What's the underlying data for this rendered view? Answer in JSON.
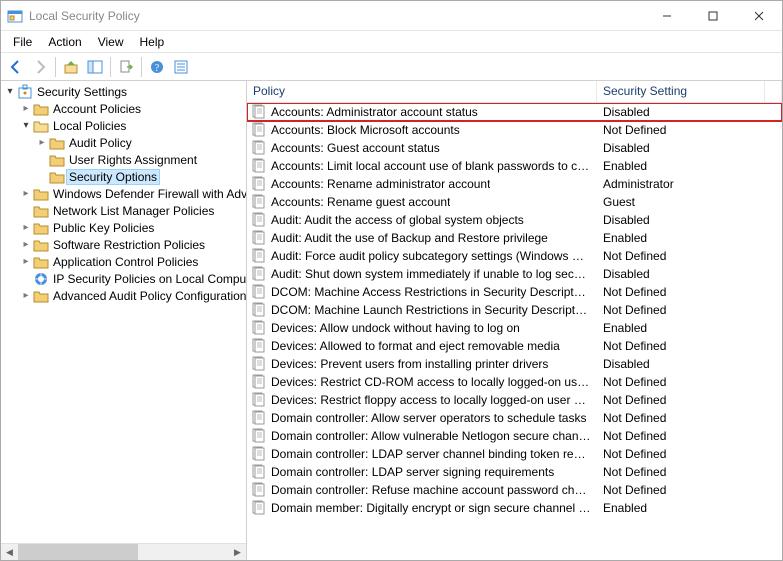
{
  "window": {
    "title": "Local Security Policy"
  },
  "menubar": [
    "File",
    "Action",
    "View",
    "Help"
  ],
  "tree": {
    "root": "Security Settings",
    "nodes": [
      {
        "label": "Account Policies",
        "indent": 1,
        "expanded": false,
        "hasChildren": true,
        "icon": "folder"
      },
      {
        "label": "Local Policies",
        "indent": 1,
        "expanded": true,
        "hasChildren": true,
        "icon": "folder-open"
      },
      {
        "label": "Audit Policy",
        "indent": 2,
        "expanded": false,
        "hasChildren": true,
        "icon": "folder"
      },
      {
        "label": "User Rights Assignment",
        "indent": 2,
        "expanded": false,
        "hasChildren": false,
        "icon": "folder"
      },
      {
        "label": "Security Options",
        "indent": 2,
        "expanded": false,
        "hasChildren": false,
        "icon": "folder",
        "selected": true
      },
      {
        "label": "Windows Defender Firewall with Advanced Security",
        "indent": 1,
        "expanded": false,
        "hasChildren": true,
        "icon": "folder"
      },
      {
        "label": "Network List Manager Policies",
        "indent": 1,
        "expanded": false,
        "hasChildren": false,
        "icon": "folder"
      },
      {
        "label": "Public Key Policies",
        "indent": 1,
        "expanded": false,
        "hasChildren": true,
        "icon": "folder"
      },
      {
        "label": "Software Restriction Policies",
        "indent": 1,
        "expanded": false,
        "hasChildren": true,
        "icon": "folder"
      },
      {
        "label": "Application Control Policies",
        "indent": 1,
        "expanded": false,
        "hasChildren": true,
        "icon": "folder"
      },
      {
        "label": "IP Security Policies on Local Computer",
        "indent": 1,
        "expanded": false,
        "hasChildren": false,
        "icon": "ipsec"
      },
      {
        "label": "Advanced Audit Policy Configuration",
        "indent": 1,
        "expanded": false,
        "hasChildren": true,
        "icon": "folder"
      }
    ]
  },
  "columns": {
    "policy": "Policy",
    "setting": "Security Setting"
  },
  "policies": [
    {
      "name": "Accounts: Administrator account status",
      "value": "Disabled",
      "highlighted": true
    },
    {
      "name": "Accounts: Block Microsoft accounts",
      "value": "Not Defined"
    },
    {
      "name": "Accounts: Guest account status",
      "value": "Disabled"
    },
    {
      "name": "Accounts: Limit local account use of blank passwords to console logon only",
      "value": "Enabled"
    },
    {
      "name": "Accounts: Rename administrator account",
      "value": "Administrator"
    },
    {
      "name": "Accounts: Rename guest account",
      "value": "Guest"
    },
    {
      "name": "Audit: Audit the access of global system objects",
      "value": "Disabled"
    },
    {
      "name": "Audit: Audit the use of Backup and Restore privilege",
      "value": "Enabled"
    },
    {
      "name": "Audit: Force audit policy subcategory settings (Windows Vista or later) to override audit policy category settings",
      "value": "Not Defined"
    },
    {
      "name": "Audit: Shut down system immediately if unable to log security audits",
      "value": "Disabled"
    },
    {
      "name": "DCOM: Machine Access Restrictions in Security Descriptor Definition Language (SDDL) syntax",
      "value": "Not Defined"
    },
    {
      "name": "DCOM: Machine Launch Restrictions in Security Descriptor Definition Language (SDDL) syntax",
      "value": "Not Defined"
    },
    {
      "name": "Devices: Allow undock without having to log on",
      "value": "Enabled"
    },
    {
      "name": "Devices: Allowed to format and eject removable media",
      "value": "Not Defined"
    },
    {
      "name": "Devices: Prevent users from installing printer drivers",
      "value": "Disabled"
    },
    {
      "name": "Devices: Restrict CD-ROM access to locally logged-on user only",
      "value": "Not Defined"
    },
    {
      "name": "Devices: Restrict floppy access to locally logged-on user only",
      "value": "Not Defined"
    },
    {
      "name": "Domain controller: Allow server operators to schedule tasks",
      "value": "Not Defined"
    },
    {
      "name": "Domain controller: Allow vulnerable Netlogon secure channel connections",
      "value": "Not Defined"
    },
    {
      "name": "Domain controller: LDAP server channel binding token requirements",
      "value": "Not Defined"
    },
    {
      "name": "Domain controller: LDAP server signing requirements",
      "value": "Not Defined"
    },
    {
      "name": "Domain controller: Refuse machine account password changes",
      "value": "Not Defined"
    },
    {
      "name": "Domain member: Digitally encrypt or sign secure channel data (always)",
      "value": "Enabled"
    }
  ]
}
